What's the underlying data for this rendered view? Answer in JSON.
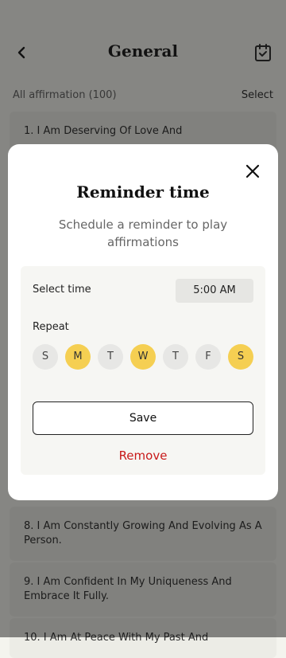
{
  "screen": {
    "title": "General",
    "section_label": "All affirmation (100)",
    "select_label": "Select"
  },
  "list": [
    "1. I Am Deserving Of Love And",
    "8. I Am Constantly Growing And Evolving As A Person.",
    "9. I Am Confident In My Uniqueness And Embrace It Fully.",
    "10. I Am At Peace With My Past And"
  ],
  "modal": {
    "title": "Reminder time",
    "subtitle": "Schedule a reminder to play affirmations",
    "select_time_label": "Select time",
    "time_value": "5:00 AM",
    "repeat_label": "Repeat",
    "days": [
      {
        "label": "S",
        "active": false
      },
      {
        "label": "M",
        "active": true
      },
      {
        "label": "T",
        "active": false
      },
      {
        "label": "W",
        "active": true
      },
      {
        "label": "T",
        "active": false
      },
      {
        "label": "F",
        "active": false
      },
      {
        "label": "S",
        "active": true
      }
    ],
    "save_label": "Save",
    "remove_label": "Remove"
  },
  "colors": {
    "accent": "#f5cf52",
    "danger": "#c81a1a"
  }
}
